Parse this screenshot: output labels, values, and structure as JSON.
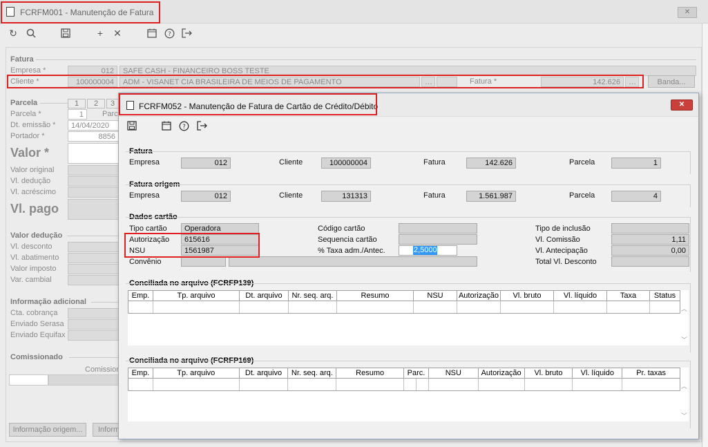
{
  "main_window": {
    "title": "FCRFM001 - Manutenção de Fatura",
    "close_glyph": "✕",
    "fatura": {
      "section": "Fatura",
      "empresa_label": "Empresa *",
      "empresa_code": "012",
      "empresa_name": "SAFE CASH - FINANCEIRO BOSS TESTE",
      "cliente_label": "Cliente *",
      "cliente_code": "100000004",
      "cliente_name": "ADM - VISANET CIA BRASILEIRA DE MEIOS DE PAGAMENTO",
      "fatura_label": "Fatura *",
      "fatura_value": "142.626",
      "banda_button": "Banda..."
    },
    "parcela": {
      "section": "Parcela",
      "tabs": [
        "1",
        "2",
        "3"
      ],
      "parcela_label": "Parcela *",
      "parcela_value": "1",
      "parcela_partial": "Parc",
      "emissao_label": "Dt. emissão *",
      "emissao_value": "14/04/2020",
      "portador_label": "Portador *",
      "portador_value": "8856",
      "valor_label": "Valor *",
      "valor_original_label": "Valor original",
      "deducao_label": "Vl. dedução",
      "acrescimo_label": "Vl. acréscimo",
      "pago_label": "Vl. pago"
    },
    "valor_deducao": {
      "section": "Valor dedução",
      "items": [
        "Vl. desconto",
        "Vl. abatimento",
        "Valor imposto",
        "Var. cambial"
      ]
    },
    "info_adicional": {
      "section": "Informação adicional",
      "items": [
        "Cta. cobrança",
        "Enviado Serasa",
        "Enviado Equifax"
      ]
    },
    "comissionado": {
      "section": "Comissionado",
      "column": "Comission"
    },
    "buttons": {
      "info_origem": "Informação origem...",
      "info_partial": "Inform"
    }
  },
  "dialog": {
    "title": "FCRFM052 - Manutenção de Fatura de Cartão de Crédito/Débito",
    "close_glyph": "✕",
    "fatura": {
      "section": "Fatura",
      "empresa_label": "Empresa",
      "empresa_value": "012",
      "cliente_label": "Cliente",
      "cliente_value": "100000004",
      "fatura_label": "Fatura",
      "fatura_value": "142.626",
      "parcela_label": "Parcela",
      "parcela_value": "1"
    },
    "fatura_origem": {
      "section": "Fatura origem",
      "empresa_label": "Empresa",
      "empresa_value": "012",
      "cliente_label": "Cliente",
      "cliente_value": "131313",
      "fatura_label": "Fatura",
      "fatura_value": "1.561.987",
      "parcela_label": "Parcela",
      "parcela_value": "4"
    },
    "dados_cartao": {
      "section": "Dados cartão",
      "tipo_label": "Tipo cartão",
      "tipo_value": "Operadora",
      "autorizacao_label": "Autorização",
      "autorizacao_value": "615616",
      "nsu_label": "NSU",
      "nsu_value": "1561987",
      "convenio_label": "Convênio",
      "codigo_label": "Código cartão",
      "sequencia_label": "Sequencia cartão",
      "taxa_label": "% Taxa adm./Antec.",
      "taxa_value": "2,5000",
      "tipo_inclusao_label": "Tipo de inclusão",
      "comissao_label": "Vl. Comissão",
      "comissao_value": "1,11",
      "antecipacao_label": "Vl. Antecipação",
      "antecipacao_value": "0,00",
      "total_desconto_label": "Total Vl. Desconto"
    },
    "table1": {
      "title": "Conciliada no arquivo (FCRFP139)",
      "columns": [
        "Emp.",
        "Tp. arquivo",
        "Dt. arquivo",
        "Nr. seq. arq.",
        "Resumo",
        "NSU",
        "Autorização",
        "Vl. bruto",
        "Vl. líquido",
        "Taxa",
        "Status"
      ]
    },
    "table2": {
      "title": "Conciliada no arquivo (FCRFP169)",
      "columns": [
        "Emp.",
        "Tp. arquivo",
        "Dt. arquivo",
        "Nr. seq. arq.",
        "Resumo",
        "Parc.",
        "NSU",
        "Autorização",
        "Vl. bruto",
        "Vl. líquido",
        "Pr. taxas"
      ]
    }
  },
  "colors": {
    "highlight": "#e02020",
    "selection": "#3399ff",
    "close_button": "#c9413a"
  }
}
